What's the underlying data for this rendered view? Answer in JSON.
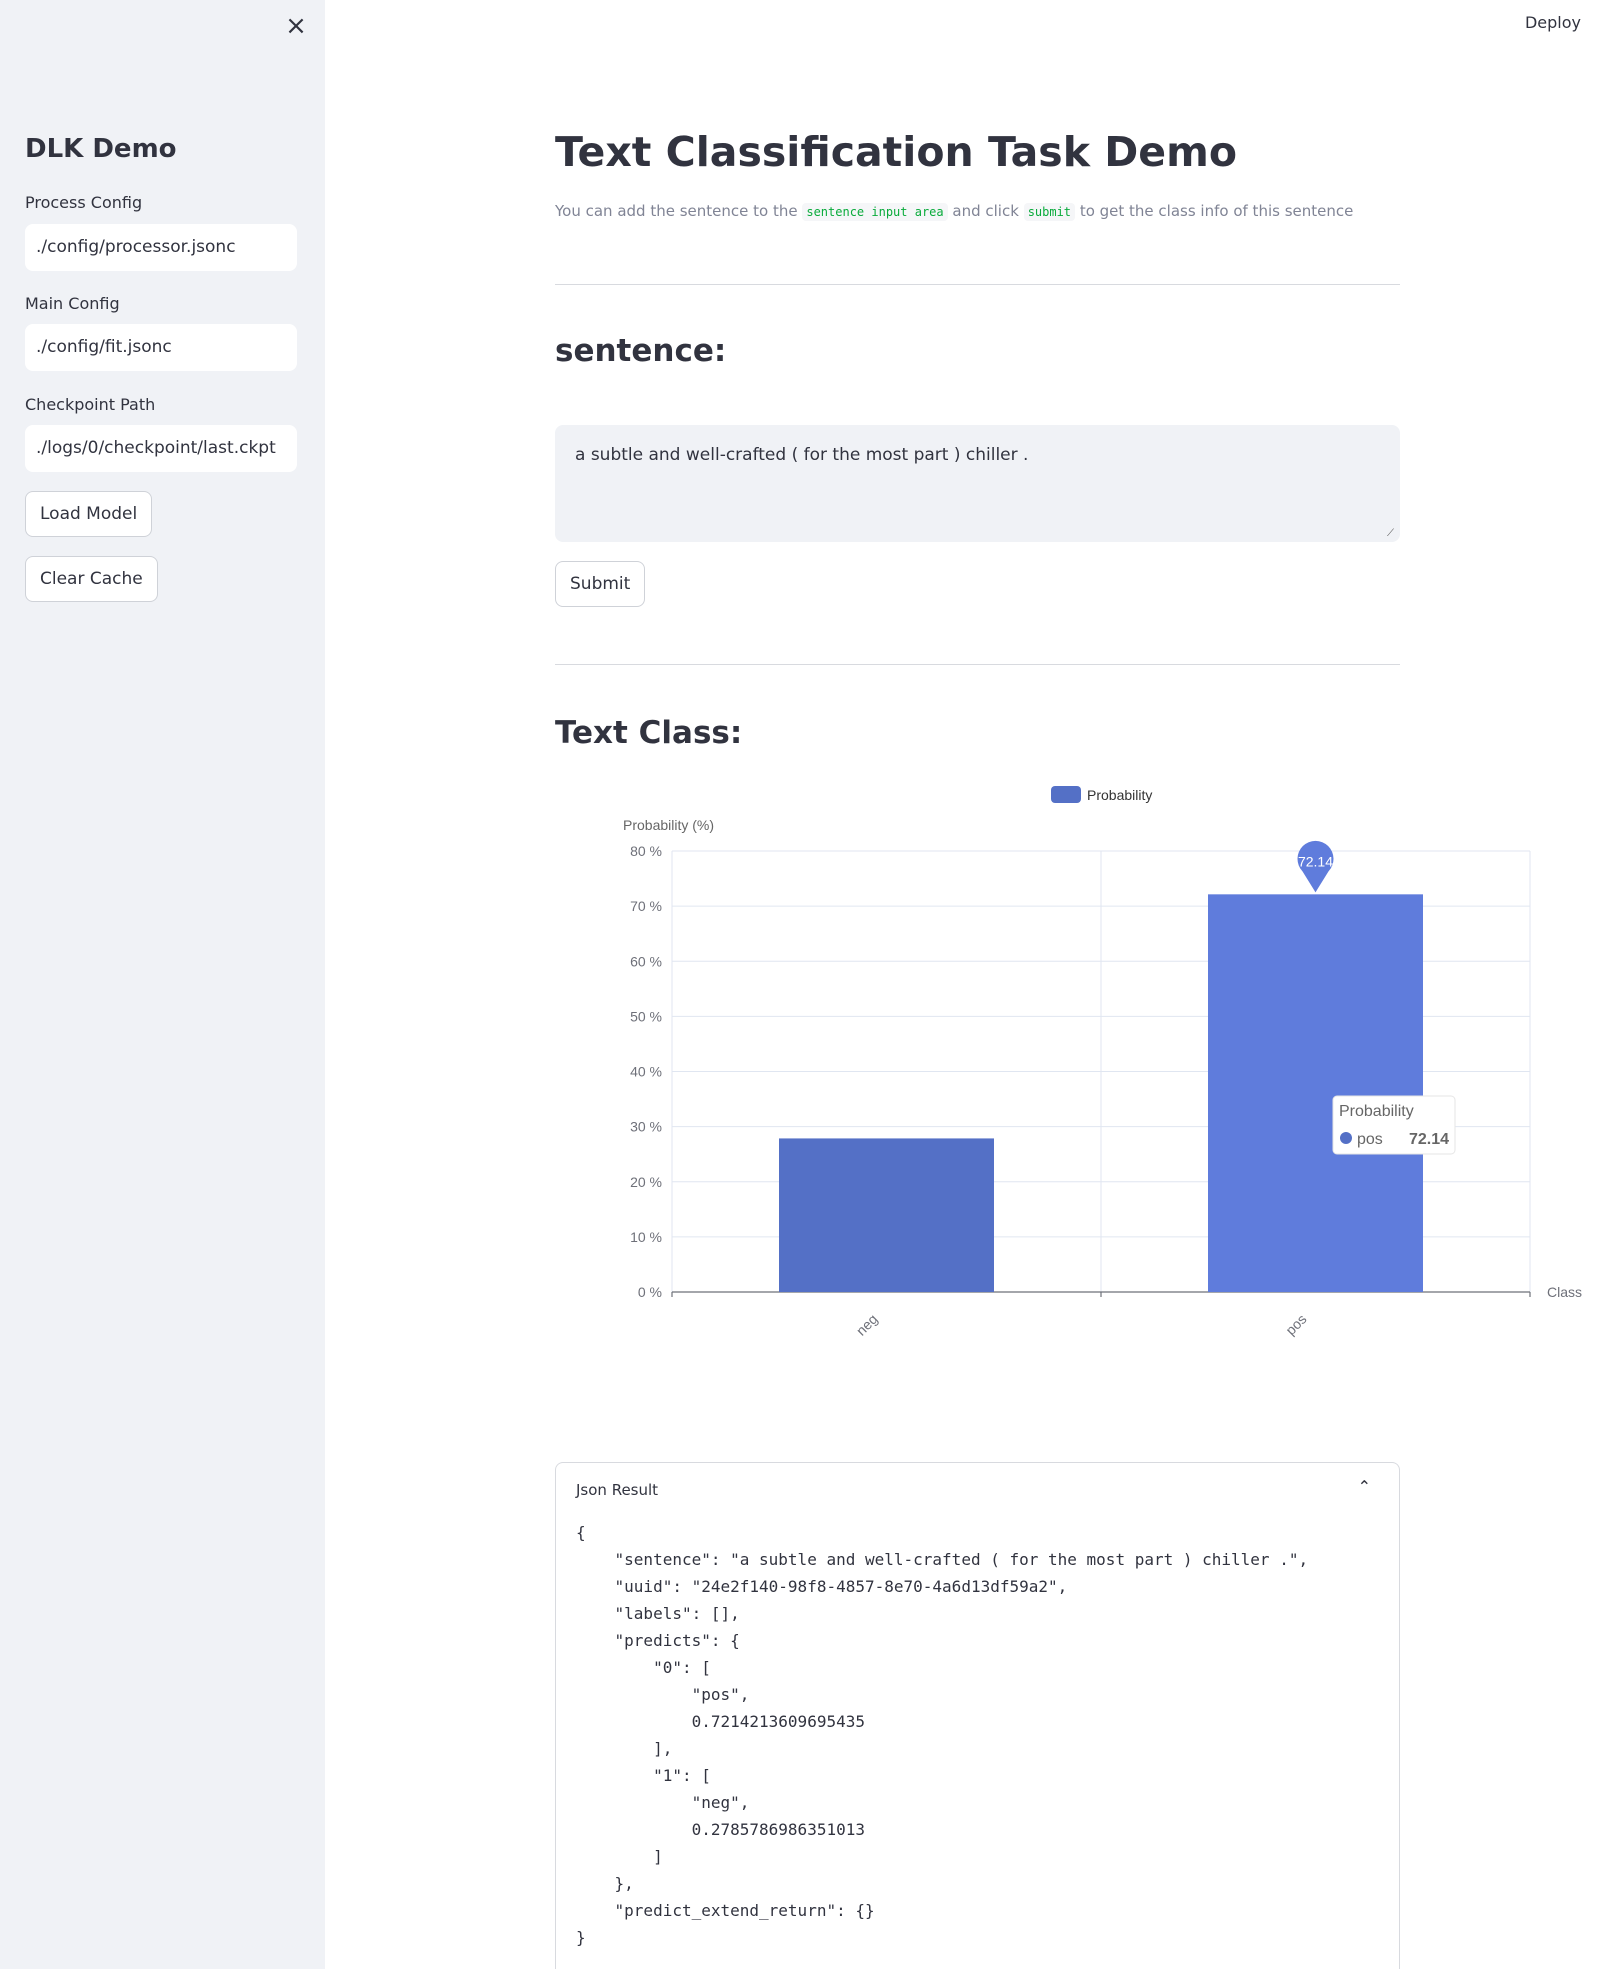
{
  "topbar": {
    "deploy_label": "Deploy"
  },
  "sidebar": {
    "close_icon": "×",
    "title": "DLK Demo",
    "process_config": {
      "label": "Process Config",
      "value": "./config/processor.jsonc"
    },
    "main_config": {
      "label": "Main Config",
      "value": "./config/fit.jsonc"
    },
    "checkpoint": {
      "label": "Checkpoint Path",
      "value": "./logs/0/checkpoint/last.ckpt"
    },
    "load_model_label": "Load Model",
    "clear_cache_label": "Clear Cache"
  },
  "main": {
    "title": "Text Classification Task Demo",
    "desc": {
      "part1": "You can add the sentence to the ",
      "code1": "sentence input area",
      "part2": " and click ",
      "code2": "submit",
      "part3": " to get the class info of this sentence"
    },
    "sentence_heading": "sentence:",
    "sentence_value": "a subtle and well-crafted ( for the most part ) chiller .",
    "submit_label": "Submit",
    "class_heading": "Text Class:"
  },
  "chart_data": {
    "type": "bar",
    "categories": [
      "neg",
      "pos"
    ],
    "series": [
      {
        "name": "Probability",
        "values": [
          27.86,
          72.14
        ]
      }
    ],
    "ylabel": "Probability (%)",
    "xlabel": "Class",
    "ylim": [
      0,
      80
    ],
    "yticks": [
      "0 %",
      "10 %",
      "20 %",
      "30 %",
      "40 %",
      "50 %",
      "60 %",
      "70 %",
      "80 %"
    ],
    "legend": "top-center",
    "grid": true,
    "markpoint_label": "72.14",
    "tooltip": {
      "title": "Probability",
      "category": "pos",
      "value": "72.14"
    },
    "colors": {
      "neg": "#5470c6",
      "pos": "#5f7cdc"
    }
  },
  "json_result": {
    "title": "Json Result",
    "chevron_icon": "⌃",
    "content": "{\n    \"sentence\": \"a subtle and well-crafted ( for the most part ) chiller .\",\n    \"uuid\": \"24e2f140-98f8-4857-8e70-4a6d13df59a2\",\n    \"labels\": [],\n    \"predicts\": {\n        \"0\": [\n            \"pos\",\n            0.7214213609695435\n        ],\n        \"1\": [\n            \"neg\",\n            0.2785786986351013\n        ]\n    },\n    \"predict_extend_return\": {}\n}"
  }
}
